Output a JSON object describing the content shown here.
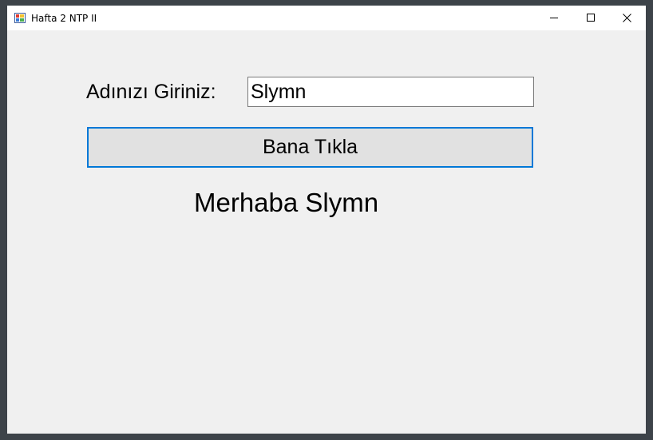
{
  "window": {
    "title": "Hafta 2 NTP II",
    "icon": "winforms-app-icon",
    "controls": [
      "minimize-icon",
      "maximize-icon",
      "close-icon"
    ]
  },
  "form": {
    "name_label": "Adınızı Giriniz:",
    "name_value": "Slymn",
    "button_label": "Bana Tıkla",
    "greeting": "Merhaba Slymn"
  },
  "colors": {
    "button_focus_border": "#0078d7",
    "form_background": "#f0f0f0"
  }
}
